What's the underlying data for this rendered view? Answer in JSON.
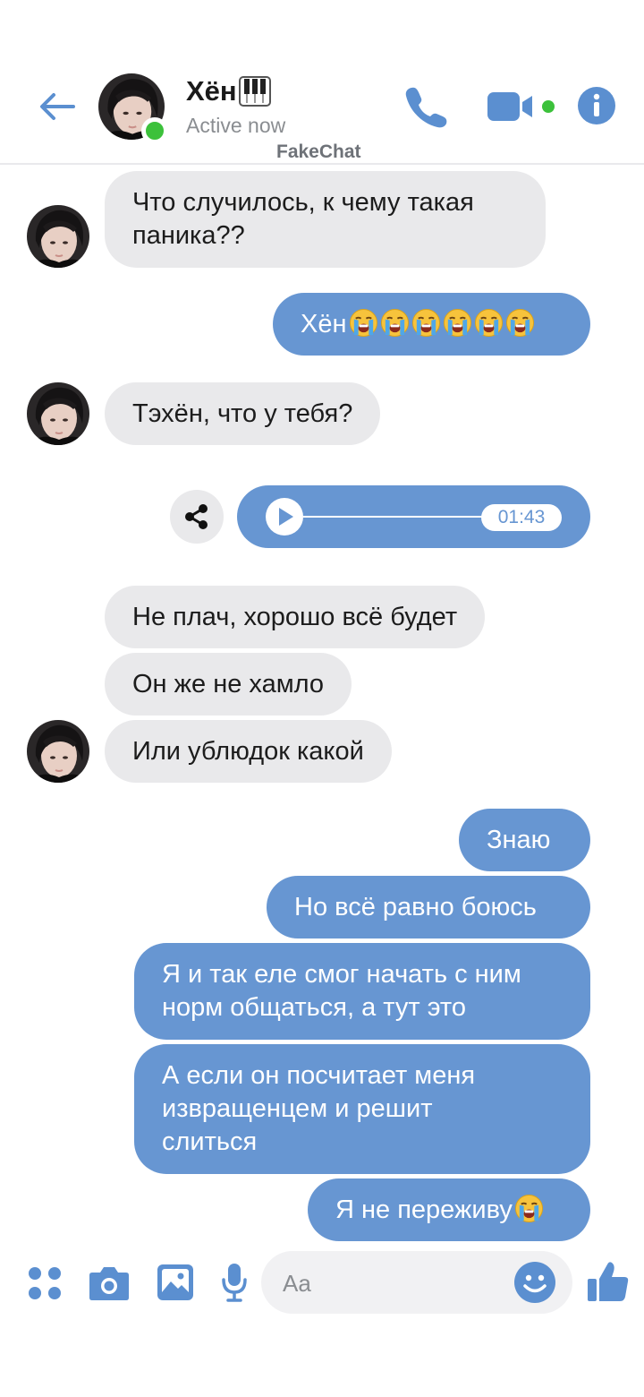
{
  "header": {
    "contact_name": "Хён",
    "status": "Active now",
    "watermark": "FakeChat"
  },
  "messages": {
    "m1": "Что случилось, к чему такая",
    "m1b": "паника??",
    "m2": "Хён",
    "m3": "Тэхён, что у тебя?",
    "voice_duration": "01:43",
    "m4": "Не плач, хорошо всё будет",
    "m5": "Он же не хамло",
    "m6": "Или ублюдок какой",
    "m7": "Знаю",
    "m8": "Но всё равно боюсь",
    "m9a": "Я и так еле смог начать с ним",
    "m9b": "норм общаться, а тут это",
    "m10a": "А если он посчитает меня",
    "m10b": "извращенцем и решит",
    "m10c": "слиться",
    "m11": "Я не переживу"
  },
  "composer": {
    "placeholder": "Aa"
  },
  "colors": {
    "accent": "#6796d2",
    "incoming_bubble": "#e9e9eb",
    "online": "#3cc13b",
    "icon_blue": "#5b8fd0"
  },
  "icons": [
    "back-arrow-icon",
    "piano-keys-icon",
    "phone-icon",
    "video-camera-icon",
    "info-icon",
    "share-icon",
    "play-icon",
    "crying-face-emoji",
    "apps-grid-icon",
    "camera-icon",
    "image-icon",
    "microphone-icon",
    "smiley-icon",
    "thumbs-up-icon"
  ]
}
